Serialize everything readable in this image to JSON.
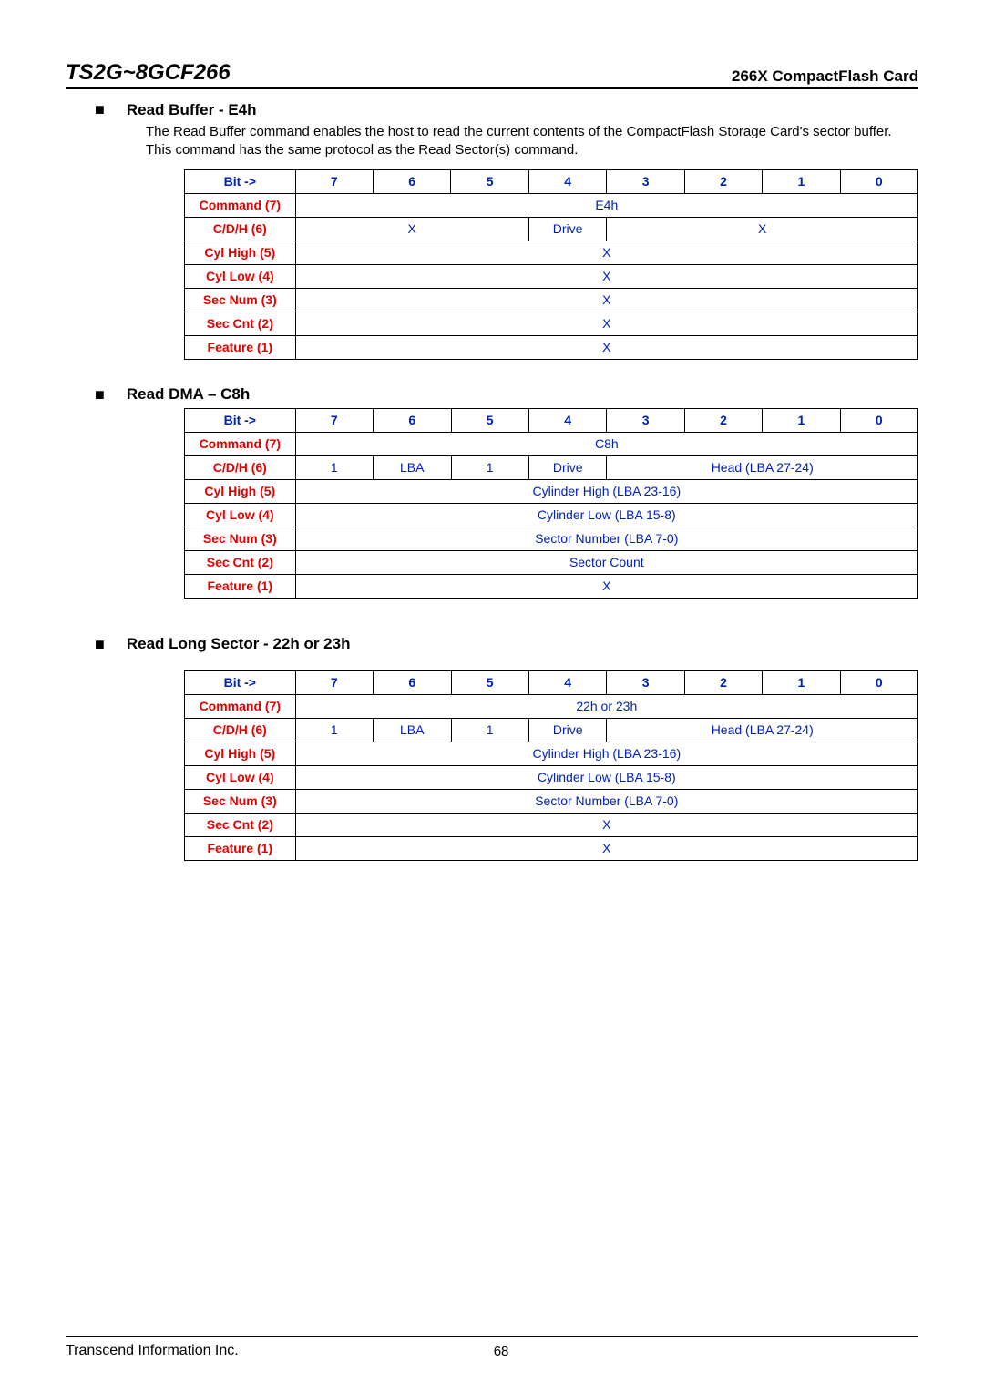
{
  "header": {
    "product_title": "TS2G~8GCF266",
    "product_subtitle": "266X CompactFlash Card"
  },
  "sections": {
    "read_buffer": {
      "title": "Read Buffer - E4h",
      "text": "The Read Buffer command enables the host to read the current contents of the CompactFlash Storage Card's sector buffer. This command has the same protocol as the Read Sector(s) command.",
      "rows": {
        "bit_label": "Bit ->",
        "command": "Command (7)",
        "cdh": "C/D/H (6)",
        "cylhigh": "Cyl High (5)",
        "cyllow": "Cyl Low (4)",
        "secnum": "Sec Num (3)",
        "seccnt": "Sec Cnt (2)",
        "feature": "Feature (1)"
      },
      "values": {
        "bit7": "7",
        "bit6": "6",
        "bit5": "5",
        "bit4": "4",
        "bit3": "3",
        "bit2": "2",
        "bit1": "1",
        "bit0": "0",
        "command_val": "E4h",
        "cdh_left": "X",
        "cdh_drive": "Drive",
        "cdh_right": "X",
        "cylhigh_val": "X",
        "cyllow_val": "X",
        "secnum_val": "X",
        "seccnt_val": "X",
        "feature_val": "X"
      }
    },
    "read_dma": {
      "title": "Read DMA – C8h",
      "rows": {
        "bit_label": "Bit ->",
        "command": "Command (7)",
        "cdh": "C/D/H (6)",
        "cylhigh": "Cyl High (5)",
        "cyllow": "Cyl Low (4)",
        "secnum": "Sec Num (3)",
        "seccnt": "Sec Cnt (2)",
        "feature": "Feature (1)"
      },
      "values": {
        "bit7": "7",
        "bit6": "6",
        "bit5": "5",
        "bit4": "4",
        "bit3": "3",
        "bit2": "2",
        "bit1": "1",
        "bit0": "0",
        "command_val": "C8h",
        "cdh_1a": "1",
        "cdh_lba": "LBA",
        "cdh_1b": "1",
        "cdh_drive": "Drive",
        "cdh_head": "Head (LBA 27-24)",
        "cylhigh_val": "Cylinder High (LBA 23-16)",
        "cyllow_val": "Cylinder Low (LBA 15-8)",
        "secnum_val": "Sector Number (LBA 7-0)",
        "seccnt_val": "Sector Count",
        "feature_val": "X"
      }
    },
    "read_long": {
      "title": "Read Long Sector - 22h or 23h",
      "rows": {
        "bit_label": "Bit ->",
        "command": "Command (7)",
        "cdh": "C/D/H (6)",
        "cylhigh": "Cyl High (5)",
        "cyllow": "Cyl Low (4)",
        "secnum": "Sec Num (3)",
        "seccnt": "Sec Cnt (2)",
        "feature": "Feature (1)"
      },
      "values": {
        "bit7": "7",
        "bit6": "6",
        "bit5": "5",
        "bit4": "4",
        "bit3": "3",
        "bit2": "2",
        "bit1": "1",
        "bit0": "0",
        "command_val": "22h or 23h",
        "cdh_1a": "1",
        "cdh_lba": "LBA",
        "cdh_1b": "1",
        "cdh_drive": "Drive",
        "cdh_head": "Head (LBA 27-24)",
        "cylhigh_val": "Cylinder High (LBA 23-16)",
        "cyllow_val": "Cylinder Low (LBA 15-8)",
        "secnum_val": "Sector Number (LBA 7-0)",
        "seccnt_val": "X",
        "feature_val": "X"
      }
    }
  },
  "footer": {
    "company": "Transcend Information Inc.",
    "page": "68"
  }
}
